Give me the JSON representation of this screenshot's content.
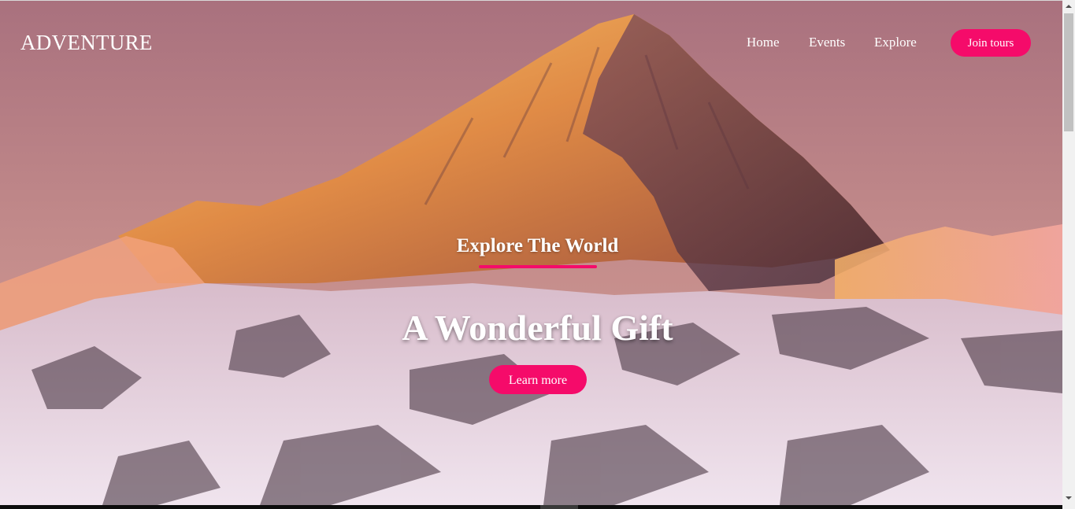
{
  "header": {
    "brand": "ADVENTURE",
    "nav": [
      {
        "label": "Home"
      },
      {
        "label": "Events"
      },
      {
        "label": "Explore"
      }
    ],
    "cta_label": "Join tours"
  },
  "hero": {
    "eyebrow": "Explore The World",
    "headline": "A Wonderful Gift",
    "button_label": "Learn more",
    "background_image": "snowy-mountain-peak-at-sunset"
  },
  "colors": {
    "accent": "#f50b6a",
    "sky": "#b07c86",
    "text": "#ffffff"
  },
  "scrollbar": {
    "up_icon": "scroll-up-arrow-icon",
    "down_icon": "scroll-down-arrow-icon"
  }
}
